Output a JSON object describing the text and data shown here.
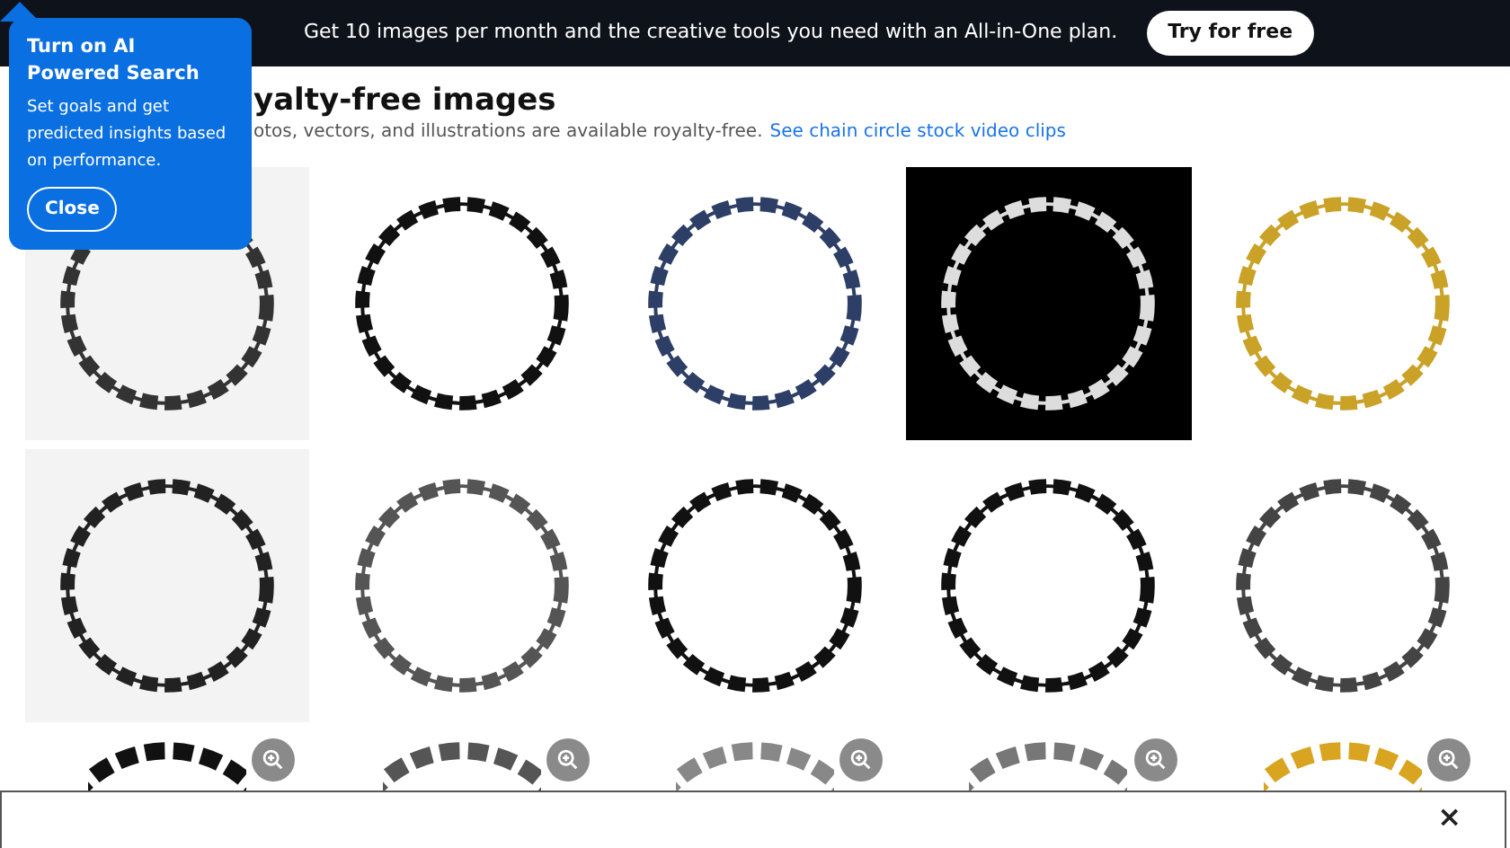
{
  "promo_bar": {
    "message": "Get 10 images per month and the creative tools you need with an All-in-One plan.",
    "button": "Try for free"
  },
  "popover": {
    "title": "Turn on AI Powered Search",
    "body": "Set goals and get predicted insights based on performance.",
    "button": "Close"
  },
  "heading": "yalty-free images",
  "subtitle": "otos, vectors, and illustrations are available royalty-free.",
  "subtitle_link": "See chain circle stock video clips",
  "cookie_panel": {
    "close": "×"
  }
}
